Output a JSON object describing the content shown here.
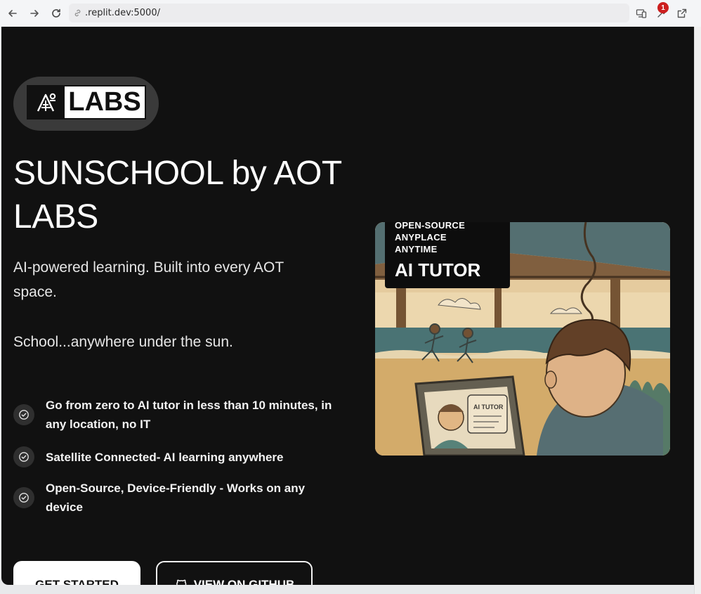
{
  "browser": {
    "url": ".replit.dev:5000/",
    "notification_count": "1"
  },
  "logo": {
    "text": "LABS"
  },
  "hero": {
    "title": "SUNSCHOOL by AOT LABS",
    "subtitle": "AI-powered learning. Built into every AOT space.",
    "tagline": "School...anywhere under the sun."
  },
  "features": [
    {
      "text": "Go from zero to AI tutor in less than 10 minutes, in any location, no IT",
      "icon": "check-circle-icon"
    },
    {
      "text": "Satellite Connected- AI learning anywhere",
      "icon": "check-circle-icon"
    },
    {
      "text": "Open-Source, Device-Friendly - Works on any device",
      "icon": "check-circle-icon"
    }
  ],
  "buttons": {
    "primary": "GET STARTED",
    "secondary": "VIEW ON GITHUB"
  },
  "image_badge": {
    "line1": "OPEN-SOURCE",
    "line2": "ANYPLACE",
    "line3": "ANYTIME",
    "big": "AI TUTOR"
  },
  "image_screen_label": "AI TUTOR",
  "colors": {
    "page_bg": "#111111",
    "accent_white": "#ffffff",
    "badge_red": "#cc1e1e"
  }
}
